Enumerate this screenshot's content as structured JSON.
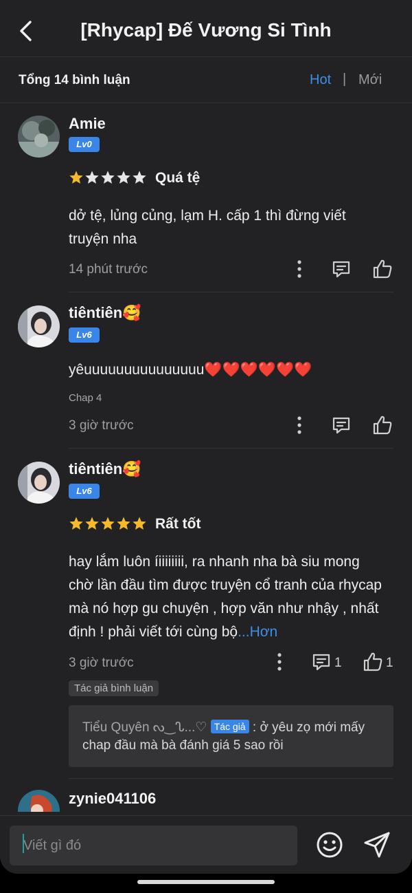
{
  "header": {
    "title": "[Rhycap] Đế Vương Si Tình"
  },
  "subheader": {
    "total": "Tổng 14 bình luận",
    "sort_hot": "Hot",
    "sort_sep": "|",
    "sort_new": "Mới"
  },
  "comments": [
    {
      "username": "Amie",
      "level": "Lv0",
      "stars": 1,
      "rating_label": "Quá tệ",
      "text": "dở tệ, lủng củng, lạm H. cấp 1 thì đừng viết truyện nha",
      "time": "14 phút trước"
    },
    {
      "username": "tiêntiên🥰",
      "level": "Lv6",
      "text": "yêuuuuuuuuuuuuuuu❤️❤️❤️❤️❤️❤️",
      "chap": "Chap 4",
      "time": "3 giờ trước"
    },
    {
      "username": "tiêntiên🥰",
      "level": "Lv6",
      "stars": 5,
      "rating_label": "Rất tốt",
      "text": "hay lắm luôn íiiiiiiii, ra nhanh nha bà siu mong chờ lần đầu tìm được truyện cổ tranh của rhycap mà nó hợp gu chuyện , hợp văn như nhậy , nhất định ! phải viết tới cùng bộ",
      "more": "...Hơn",
      "time": "3 giờ trước",
      "reply_count": "1",
      "like_count": "1",
      "author_tag": "Tác giả bình luận",
      "reply": {
        "name": "Tiểu Quyên ᔓ‿ᔐ...♡",
        "badge": "Tác giả",
        "text": ": ở yêu zọ mới mấy chap đầu mà bà đánh giá 5 sao rồi"
      }
    },
    {
      "username": "zynie041106"
    }
  ],
  "input": {
    "placeholder": "Viết gì đó"
  },
  "colors": {
    "accent": "#3f8ee6",
    "star": "#f5b92b",
    "background": "#222224"
  }
}
